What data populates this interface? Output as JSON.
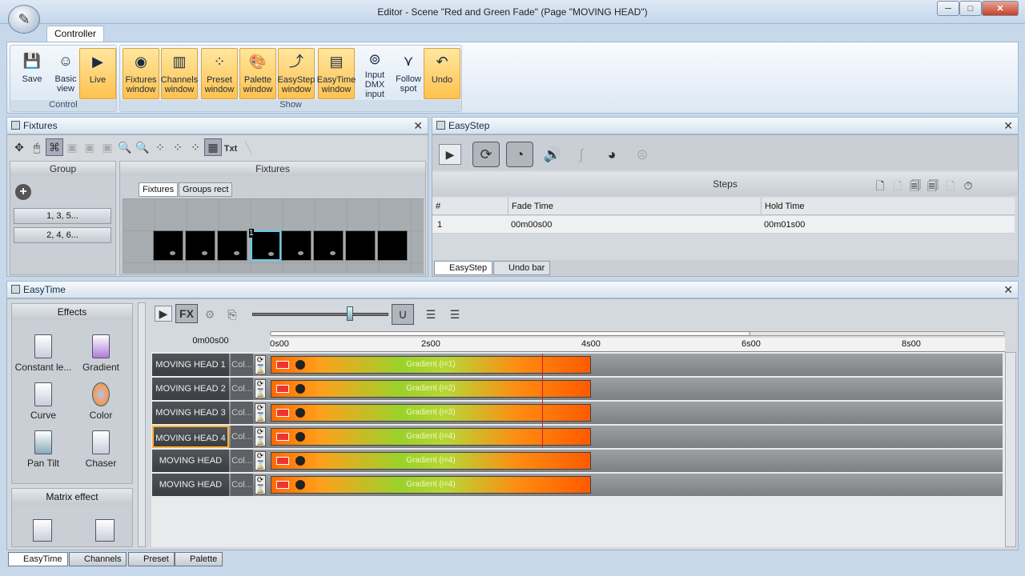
{
  "window": {
    "title": "Editor - Scene \"Red and Green Fade\" (Page \"MOVING HEAD\")"
  },
  "ribbon": {
    "tab": "Controller",
    "groups": [
      {
        "label": "Control",
        "buttons": [
          "Save",
          "Basic view",
          "Live"
        ]
      },
      {
        "label": "Show",
        "buttons": [
          "Fixtures window",
          "Channels window",
          "Preset window",
          "Palette window",
          "EasyStep window",
          "EasyTime window",
          "Input DMX input",
          "Follow spot",
          "Undo"
        ]
      }
    ]
  },
  "fixtures": {
    "title": "Fixtures",
    "group_header": "Group",
    "fixtures_header": "Fixtures",
    "groups": [
      "1, 3, 5...",
      "2, 4, 6..."
    ],
    "tabs": [
      "Fixtures",
      "Groups rect"
    ],
    "txt_label": "Txt",
    "selected_number": "1"
  },
  "easystep": {
    "title": "EasyStep",
    "steps_header": "Steps",
    "columns": [
      "#",
      "Fade Time",
      "Hold Time"
    ],
    "rows": [
      {
        "num": "1",
        "fade": "00m00s00",
        "hold": "00m01s00"
      }
    ],
    "tabs": [
      "EasyStep",
      "Undo bar"
    ]
  },
  "easytime": {
    "title": "EasyTime",
    "effects_header": "Effects",
    "effects": [
      "Constant le...",
      "Gradient",
      "Curve",
      "Color",
      "Pan Tilt",
      "Chaser"
    ],
    "matrix_header": "Matrix effect",
    "time_display": "0m00s00",
    "ruler": [
      "0s00",
      "2s00",
      "4s00",
      "6s00",
      "8s00"
    ],
    "tracks": [
      {
        "name": "MOVING HEAD  1",
        "col": "Col...",
        "effect": "Gradient (i=1)"
      },
      {
        "name": "MOVING HEAD  2",
        "col": "Col...",
        "effect": "Gradient (i=2)"
      },
      {
        "name": "MOVING HEAD  3",
        "col": "Col...",
        "effect": "Gradient (i=3)"
      },
      {
        "name": "MOVING HEAD  4",
        "col": "Col...",
        "effect": "Gradient (i=4)"
      },
      {
        "name": "MOVING HEAD",
        "col": "Col...",
        "effect": "Gradient (i=4)"
      },
      {
        "name": "MOVING HEAD",
        "col": "Col...",
        "effect": "Gradient (i=4)"
      }
    ],
    "bottom_tabs": [
      "EasyTime",
      "Channels",
      "Preset",
      "Palette"
    ]
  },
  "colors": {
    "accent": "#ffc14d",
    "playhead": "#cc2222"
  }
}
